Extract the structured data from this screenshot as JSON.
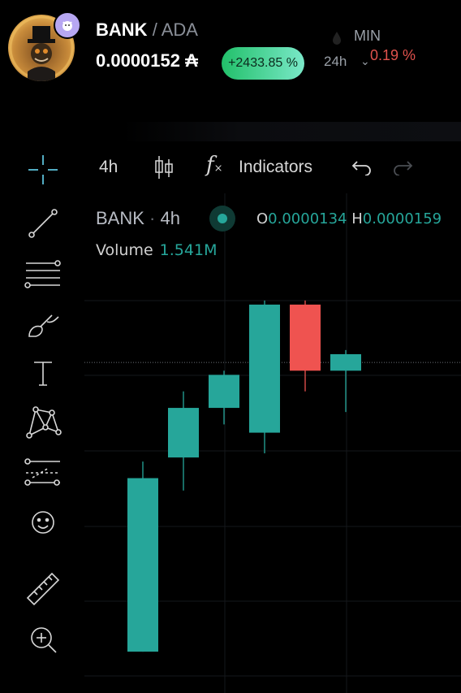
{
  "header": {
    "symbol": "BANK",
    "separator": "/",
    "quote": "ADA",
    "price": "0.0000152",
    "currency_symbol": "₳",
    "change": "+2433.85 %",
    "period": "24h",
    "min_label": "MIN",
    "min_value": "0.19 %",
    "colors": {
      "up": "#26a69a",
      "down": "#ef5350",
      "badge_up": "#22c06a"
    }
  },
  "toolbar": {
    "timeframe": "4h",
    "candle_icon": "candlestick-icon",
    "fx_icon": "function-icon",
    "indicators_label": "Indicators",
    "undo_icon": "undo-icon",
    "redo_icon": "redo-icon"
  },
  "tools": [
    "crosshair-icon",
    "trendline-icon",
    "fib-retracement-icon",
    "brush-icon",
    "text-icon",
    "pattern-icon",
    "prediction-icon",
    "emoji-icon",
    "ruler-icon",
    "zoom-in-icon"
  ],
  "legend": {
    "symbol": "BANK",
    "timeframe": "4h",
    "open_label": "O",
    "open_value": "0.0000134",
    "high_label": "H",
    "high_value": "0.0000159",
    "volume_label": "Volume",
    "volume_value": "1.541M"
  },
  "chart_data": {
    "type": "candlestick",
    "title": "",
    "xlabel": "",
    "ylabel": "",
    "ylim": [
      7.2e-06,
      1.65e-05
    ],
    "last_price": 1.52e-05,
    "grid": true,
    "candles": [
      {
        "o": 8.2e-06,
        "h": 1.28e-05,
        "l": 8.2e-06,
        "c": 1.24e-05
      },
      {
        "o": 1.29e-05,
        "h": 1.45e-05,
        "l": 1.21e-05,
        "c": 1.41e-05
      },
      {
        "o": 1.41e-05,
        "h": 1.5e-05,
        "l": 1.37e-05,
        "c": 1.49e-05
      },
      {
        "o": 1.35e-05,
        "h": 1.67e-05,
        "l": 1.3e-05,
        "c": 1.66e-05
      },
      {
        "o": 1.66e-05,
        "h": 1.67e-05,
        "l": 1.45e-05,
        "c": 1.5e-05
      },
      {
        "o": 1.5e-05,
        "h": 1.55e-05,
        "l": 1.4e-05,
        "c": 1.54e-05
      }
    ]
  }
}
